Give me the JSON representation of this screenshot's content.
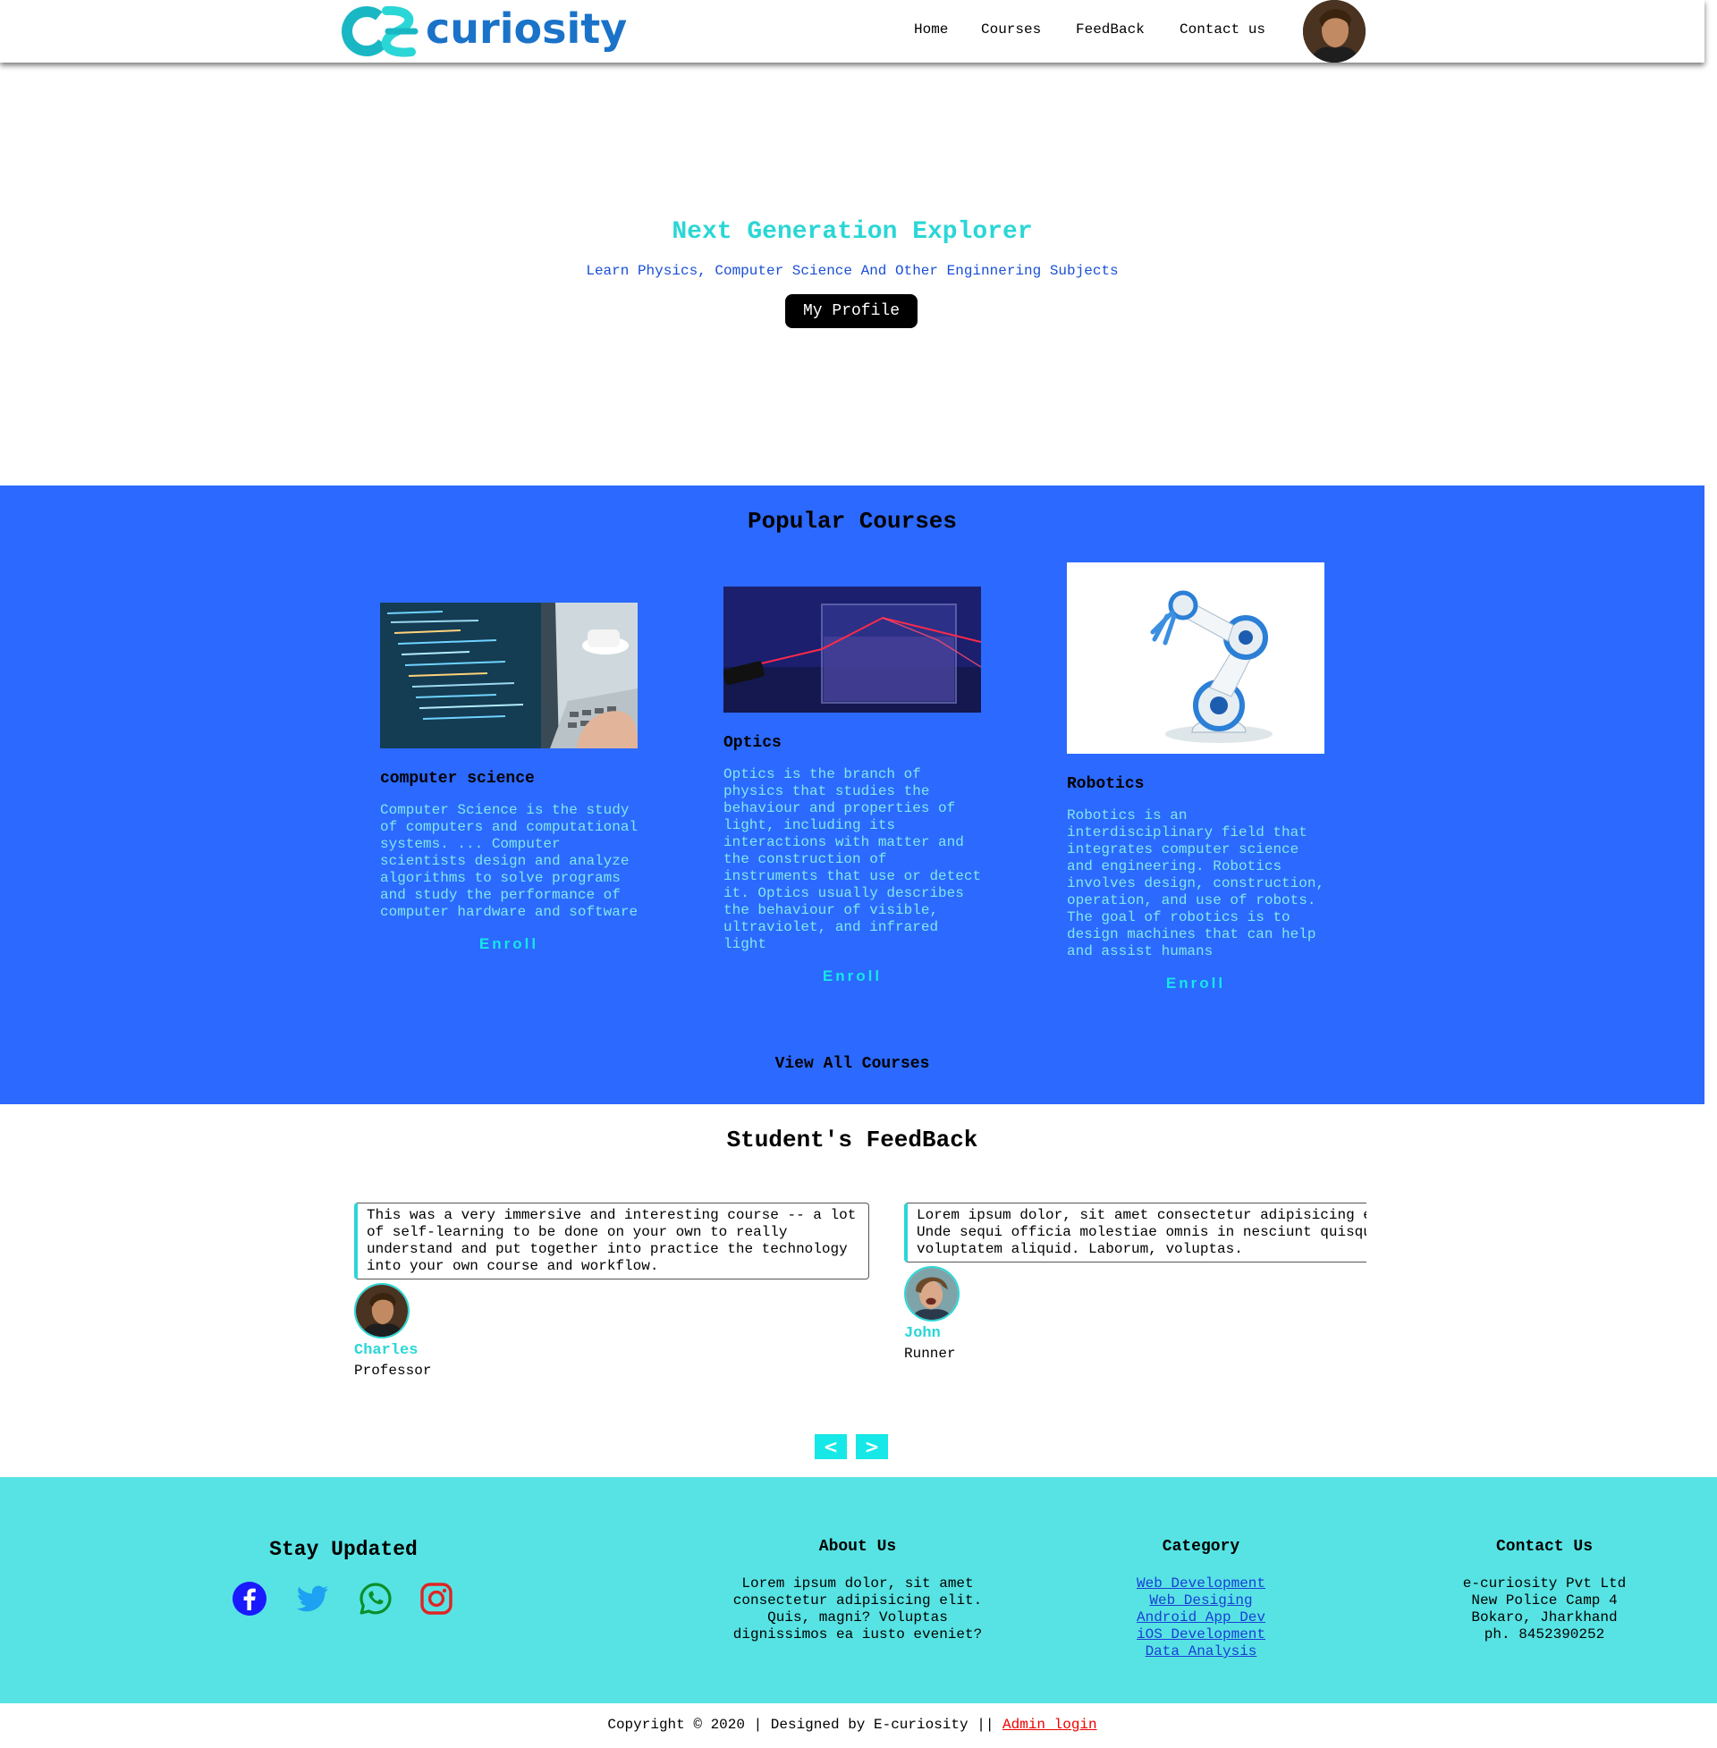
{
  "header": {
    "logo_text": "curiosity",
    "nav": [
      {
        "label": "Home"
      },
      {
        "label": "Courses"
      },
      {
        "label": "FeedBack"
      },
      {
        "label": "Contact us"
      }
    ]
  },
  "hero": {
    "title": "Next Generation Explorer",
    "subtitle": "Learn Physics, Computer Science And Other Enginnering Subjects",
    "button": "My Profile"
  },
  "courses": {
    "title": "Popular Courses",
    "items": [
      {
        "title": "computer science",
        "description": "Computer Science is the study of computers and computational systems. ... Computer scientists design and analyze algorithms to solve programs and study the performance of computer hardware and software",
        "enroll": "Enroll"
      },
      {
        "title": "Optics",
        "description": "Optics is the branch of physics that studies the behaviour and properties of light, including its interactions with matter and the construction of instruments that use or detect it. Optics usually describes the behaviour of visible, ultraviolet, and infrared light",
        "enroll": "Enroll"
      },
      {
        "title": "Robotics",
        "description": "Robotics is an interdisciplinary field that integrates computer science and engineering. Robotics involves design, construction, operation, and use of robots. The goal of robotics is to design machines that can help and assist humans",
        "enroll": "Enroll"
      }
    ],
    "view_all": "View All Courses"
  },
  "feedback": {
    "title": "Student's FeedBack",
    "items": [
      {
        "quote": "This was a very immersive and interesting course -- a lot of self-learning to be done on your own to really understand and put together into practice the technology into your own course and workflow.",
        "name": "Charles",
        "role": "Professor"
      },
      {
        "quote": "Lorem ipsum dolor, sit amet consectetur adipisicing elit. Unde sequi officia molestiae omnis in nesciunt quisquam voluptatem aliquid. Laborum, voluptas.",
        "name": "John",
        "role": "Runner"
      }
    ],
    "prev": "<",
    "next": ">"
  },
  "footer": {
    "stay_updated": "Stay Updated",
    "social": [
      {
        "icon": "facebook-icon",
        "color": "#1a1aff"
      },
      {
        "icon": "twitter-icon",
        "color": "#1da1f2"
      },
      {
        "icon": "whatsapp-icon",
        "color": "#0a8f2a"
      },
      {
        "icon": "instagram-icon",
        "color": "#e02424"
      }
    ],
    "about": {
      "title": "About Us",
      "text": "Lorem ipsum dolor, sit amet consectetur adipisicing elit. Quis, magni? Voluptas dignissimos ea iusto eveniet?"
    },
    "category": {
      "title": "Category",
      "links": [
        "Web Development",
        "Web Desiging",
        "Android App Dev",
        "iOS Development",
        "Data Analysis"
      ]
    },
    "contact": {
      "title": "Contact Us",
      "lines": [
        "e-curiosity Pvt Ltd",
        "New Police Camp 4",
        "Bokaro, Jharkhand",
        "ph. 8452390252"
      ]
    }
  },
  "copyright": {
    "text": "Copyright © 2020 | Designed by E-curiosity || ",
    "admin_link": "Admin login"
  }
}
